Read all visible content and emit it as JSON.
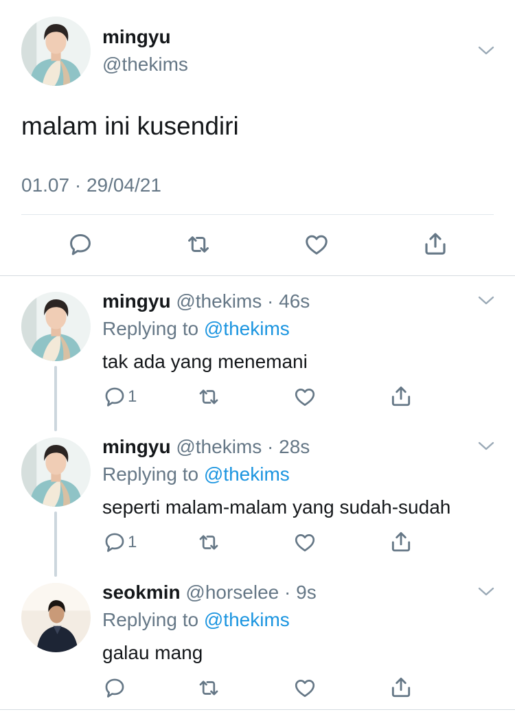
{
  "main_tweet": {
    "name": "mingyu",
    "handle": "@thekims",
    "text": "malam ini kusendiri",
    "timestamp": "01.07 · 29/04/21",
    "avatar": "profile-photo"
  },
  "replies": [
    {
      "name": "mingyu",
      "handle": "@thekims",
      "sep": " · ",
      "time": "46s",
      "replying_prefix": "Replying to ",
      "replying_to": "@thekims",
      "text": "tak ada yang menemani",
      "reply_count": "1"
    },
    {
      "name": "mingyu",
      "handle": "@thekims",
      "sep": " · ",
      "time": "28s",
      "replying_prefix": "Replying to ",
      "replying_to": "@thekims",
      "text": "seperti malam-malam yang sudah-sudah",
      "reply_count": "1"
    },
    {
      "name": "seokmin",
      "handle": "@horselee",
      "sep": " · ",
      "time": "9s",
      "replying_prefix": "Replying to ",
      "replying_to": "@thekims",
      "text": "galau mang",
      "reply_count": ""
    }
  ],
  "icons": [
    "reply-icon",
    "retweet-icon",
    "like-icon",
    "share-icon",
    "chevron-down-icon"
  ],
  "colors": {
    "text": "#14171a",
    "secondary": "#657786",
    "link": "#1b95e0",
    "divider": "#e1e8ed",
    "thread_line": "#ccd6dd"
  }
}
